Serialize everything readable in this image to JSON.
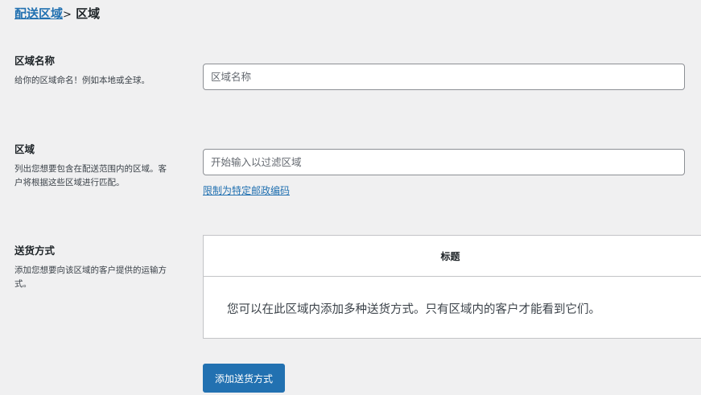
{
  "breadcrumb": {
    "parent_link": "配送区域",
    "separator": ">",
    "current": "区域"
  },
  "zone_name": {
    "label": "区域名称",
    "description": "给你的区域命名！例如本地或全球。",
    "placeholder": "区域名称",
    "value": ""
  },
  "zone_regions": {
    "label": "区域",
    "description": "列出您想要包含在配送范围内的区域。客户将根据这些区域进行匹配。",
    "placeholder": "开始输入以过滤区域",
    "value": "",
    "postcode_link": "限制为特定邮政编码"
  },
  "shipping_methods": {
    "label": "送货方式",
    "description": "添加您想要向该区域的客户提供的运输方式。",
    "table_header": "标题",
    "empty_message": "您可以在此区域内添加多种送货方式。只有区域内的客户才能看到它们。",
    "add_button": "添加送货方式"
  },
  "colors": {
    "accent": "#2271b1",
    "background": "#f0f0f1",
    "border": "#8c8f94"
  }
}
